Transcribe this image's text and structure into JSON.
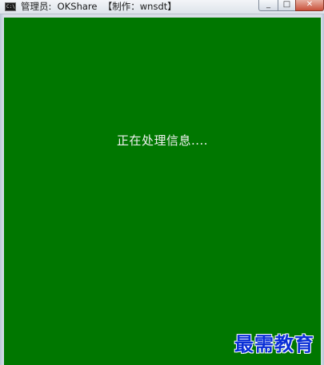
{
  "window": {
    "icon_glyph": "C:\\",
    "title": "管理员:  OKShare  【制作：wnsdt】",
    "controls": {
      "minimize": "_",
      "maximize": "□",
      "close": "✕"
    }
  },
  "console": {
    "background_color": "#007700",
    "text_color": "#f2f2f2",
    "message": "正在处理信息...."
  },
  "watermark": {
    "text": "最需教育",
    "color": "#0a2fd6"
  }
}
